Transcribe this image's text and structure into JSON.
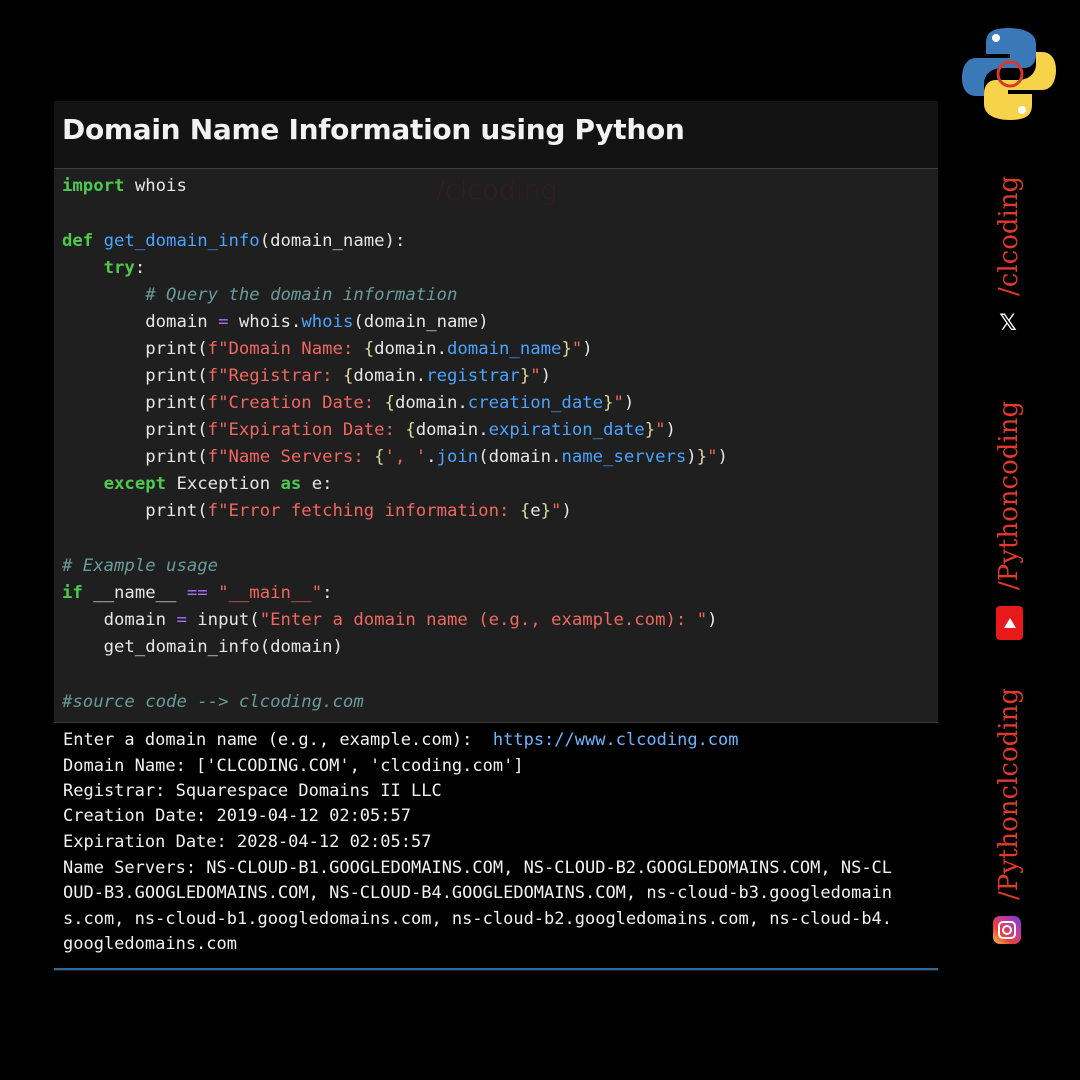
{
  "header": {
    "title": "Domain Name Information using Python"
  },
  "watermark": "/clcoding",
  "code": {
    "l1_kw": "import",
    "l1_rest": " whois",
    "l3_kw": "def",
    "l3_fn": "get_domain_info",
    "l3_rest": "(domain_name):",
    "l4_kw": "try",
    "l4_rest": ":",
    "l5_cm": "# Query the domain information",
    "l6_a": "domain ",
    "l6_op": "=",
    "l6_b": " whois.",
    "l6_fn": "whois",
    "l6_c": "(domain_name)",
    "l7_a": "print(",
    "l7_s1": "f\"Domain Name: ",
    "l7_b1": "{",
    "l7_v": "domain.",
    "l7_attr": "domain_name",
    "l7_b2": "}",
    "l7_s2": "\"",
    "l7_c": ")",
    "l8_a": "print(",
    "l8_s1": "f\"Registrar: ",
    "l8_b1": "{",
    "l8_v": "domain.",
    "l8_attr": "registrar",
    "l8_b2": "}",
    "l8_s2": "\"",
    "l8_c": ")",
    "l9_a": "print(",
    "l9_s1": "f\"Creation Date: ",
    "l9_b1": "{",
    "l9_v": "domain.",
    "l9_attr": "creation_date",
    "l9_b2": "}",
    "l9_s2": "\"",
    "l9_c": ")",
    "l10_a": "print(",
    "l10_s1": "f\"Expiration Date: ",
    "l10_b1": "{",
    "l10_v": "domain.",
    "l10_attr": "expiration_date",
    "l10_b2": "}",
    "l10_s2": "\"",
    "l10_c": ")",
    "l11_a": "print(",
    "l11_s1": "f\"Name Servers: ",
    "l11_b1": "{",
    "l11_s3": "', '",
    "l11_v": ".",
    "l11_fn": "join",
    "l11_v2": "(domain.",
    "l11_attr": "name_servers",
    "l11_v3": ")",
    "l11_b2": "}",
    "l11_s2": "\"",
    "l11_c": ")",
    "l12_kw": "except",
    "l12_a": " Exception ",
    "l12_kw2": "as",
    "l12_b": " e:",
    "l13_a": "print(",
    "l13_s1": "f\"Error fetching information: ",
    "l13_b1": "{",
    "l13_v": "e",
    "l13_b2": "}",
    "l13_s2": "\"",
    "l13_c": ")",
    "l15_cm": "# Example usage",
    "l16_kw": "if",
    "l16_a": " __name__ ",
    "l16_op": "==",
    "l16_sp": " ",
    "l16_s": "\"__main__\"",
    "l16_b": ":",
    "l17_a": "domain ",
    "l17_op": "=",
    "l17_b": " input(",
    "l17_s": "\"Enter a domain name (e.g., example.com): \"",
    "l17_c": ")",
    "l18_a": "get_domain_info(domain)",
    "l20_cm": "#source code --> clcoding.com"
  },
  "output": {
    "line1_prompt": "Enter a domain name (e.g., example.com):  ",
    "line1_input": "https://www.clcoding.com",
    "line2": "Domain Name: ['CLCODING.COM', 'clcoding.com']",
    "line3": "Registrar: Squarespace Domains II LLC",
    "line4": "Creation Date: 2019-04-12 02:05:57",
    "line5": "Expiration Date: 2028-04-12 02:05:57",
    "line6": "Name Servers: NS-CLOUD-B1.GOOGLEDOMAINS.COM, NS-CLOUD-B2.GOOGLEDOMAINS.COM, NS-CL",
    "line7": "OUD-B3.GOOGLEDOMAINS.COM, NS-CLOUD-B4.GOOGLEDOMAINS.COM, ns-cloud-b3.googledomain",
    "line8": "s.com, ns-cloud-b1.googledomains.com, ns-cloud-b2.googledomains.com, ns-cloud-b4.",
    "line9": "googledomains.com"
  },
  "sidebar": {
    "handle_x": "/clcoding",
    "x_icon": "𝕏",
    "handle_youtube": "/Pythoncoding",
    "handle_instagram": "/Pythonclcoding"
  },
  "colors": {
    "accent_red": "#e03a2a",
    "keyword": "#4ec94e",
    "function": "#4aa3ff",
    "string": "#f0675f",
    "comment": "#6a9a9a"
  },
  "icons": [
    "python-logo-icon",
    "x-icon",
    "youtube-icon",
    "instagram-icon"
  ]
}
